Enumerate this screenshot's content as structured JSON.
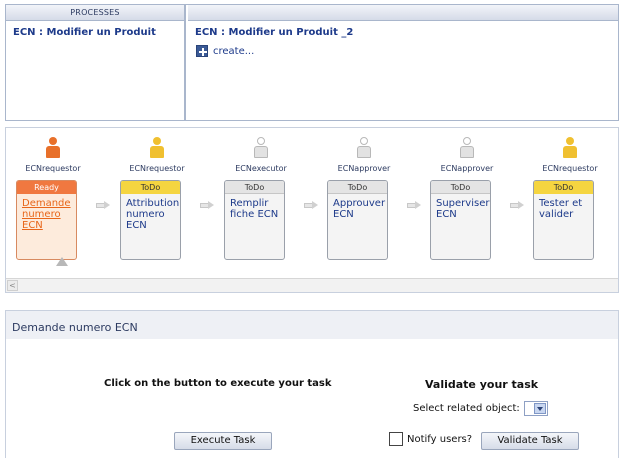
{
  "processes": {
    "header": "PROCESSES",
    "left_title": "ECN : Modifier un Produit",
    "right_title": "ECN : Modifier un Produit _2",
    "create_label": "create..."
  },
  "workflow": {
    "steps": [
      {
        "role": "ECNrequestor",
        "status": "Ready",
        "task": [
          "Demande",
          "numero",
          "ECN"
        ],
        "person_color": "orange",
        "status_color": "orange"
      },
      {
        "role": "ECNrequestor",
        "status": "ToDo",
        "task": [
          "Attribution",
          "numero",
          "ECN"
        ],
        "person_color": "yellow",
        "status_color": "yellow"
      },
      {
        "role": "ECNexecutor",
        "status": "ToDo",
        "task": [
          "Remplir",
          "fiche ECN"
        ],
        "person_color": "grey",
        "status_color": "grey"
      },
      {
        "role": "ECNapprover",
        "status": "ToDo",
        "task": [
          "Approuver",
          "ECN"
        ],
        "person_color": "grey",
        "status_color": "grey"
      },
      {
        "role": "ECNapprover",
        "status": "ToDo",
        "task": [
          "Superviser",
          "ECN"
        ],
        "person_color": "grey",
        "status_color": "grey"
      },
      {
        "role": "ECNrequestor",
        "status": "ToDo",
        "task": [
          "Tester et",
          "valider"
        ],
        "person_color": "yellow",
        "status_color": "yellow"
      }
    ]
  },
  "form": {
    "header": "Demande numero ECN",
    "execute_title": "Click on the button to execute your task",
    "validate_title": "Validate your task",
    "select_label": "Select related object:",
    "notify_label": "Notify users?",
    "execute_button": "Execute Task",
    "validate_button": "Validate Task"
  },
  "colors": {
    "accent_blue": "#1d3a8a",
    "ready_orange": "#f07840",
    "todo_yellow": "#f5d540"
  }
}
